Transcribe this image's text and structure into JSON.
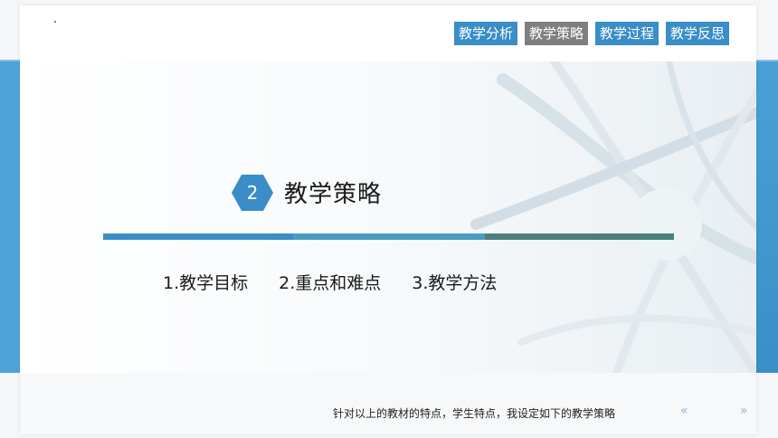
{
  "nav": {
    "tabs": [
      {
        "label": "教学分析",
        "active": false
      },
      {
        "label": "教学策略",
        "active": true
      },
      {
        "label": "教学过程",
        "active": false
      },
      {
        "label": "教学反思",
        "active": false
      }
    ]
  },
  "section": {
    "number": "2",
    "title": "教学策略"
  },
  "items": [
    "1.教学目标",
    "2.重点和难点",
    "3.教学方法"
  ],
  "footer": {
    "text": "针对以上的教材的特点，学生特点，我设定如下的教学策略",
    "prev_glyph": "«",
    "next_glyph": "»"
  },
  "colors": {
    "accent_blue": "#3a8dc6",
    "active_tab": "#7f7f7f",
    "bar_teal": "#4b9bbf",
    "bar_green": "#4a7f7c"
  }
}
